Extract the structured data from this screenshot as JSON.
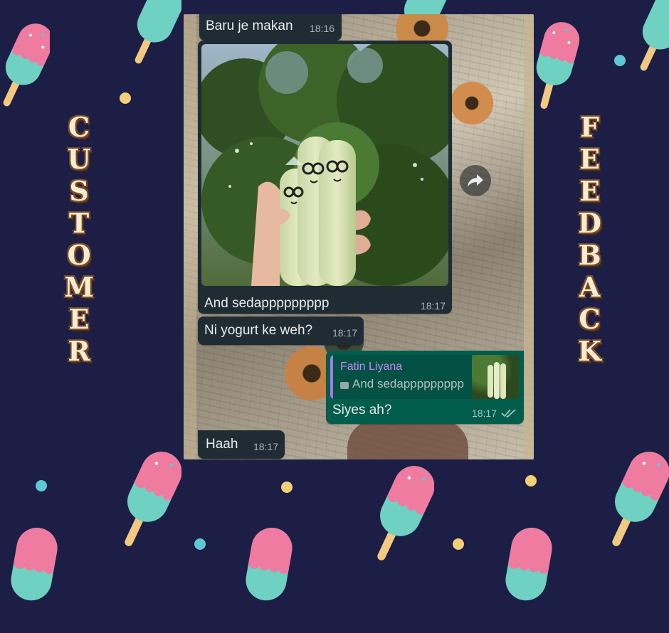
{
  "left_title_letters": [
    "C",
    "U",
    "S",
    "T",
    "O",
    "M",
    "E",
    "R"
  ],
  "right_title_letters": [
    "F",
    "E",
    "E",
    "D",
    "B",
    "A",
    "C",
    "K"
  ],
  "chat": {
    "msg1": {
      "text": "Baru je makan",
      "time": "18:16"
    },
    "msg2": {
      "text": "And sedappppppppp",
      "time": "18:17"
    },
    "msg3": {
      "text": "Ni yogurt ke weh?",
      "time": "18:17"
    },
    "msg4": {
      "quote_author": "Fatin Liyana",
      "quote_text": "And sedappppppppp",
      "text": "Siyes ah?",
      "time": "18:17",
      "status_icon": "double-check-icon"
    },
    "msg5": {
      "text": "Haah",
      "time": "18:17"
    }
  },
  "icons": {
    "forward": "forward-arrow-icon",
    "quote_media": "image-icon"
  },
  "colors": {
    "background": "#1d1e46",
    "incoming_bubble": "#1f2c34",
    "outgoing_bubble": "#005c4b",
    "quote_author": "#c58af9",
    "title_fill": "#f7ecd2",
    "title_outline": "#7a4a25"
  }
}
